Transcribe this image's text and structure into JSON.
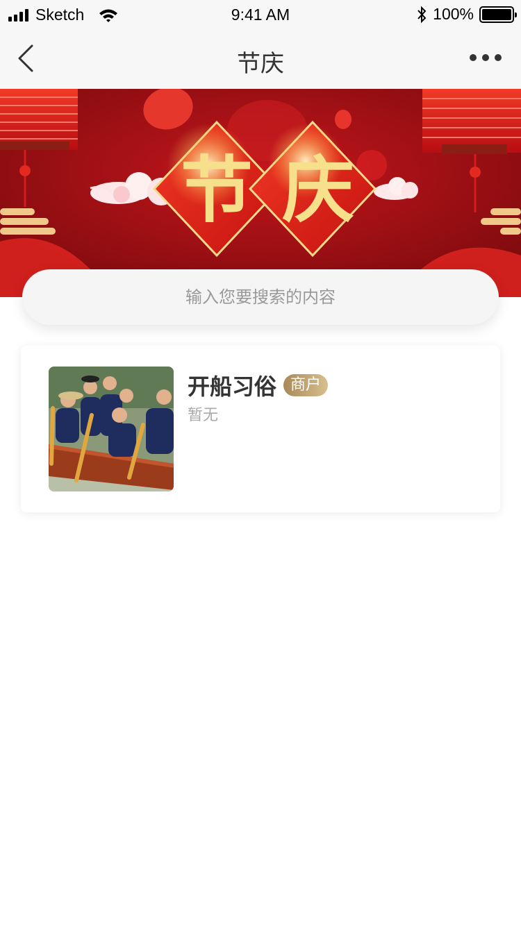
{
  "status_bar": {
    "carrier": "Sketch",
    "time": "9:41 AM",
    "battery": "100%"
  },
  "nav": {
    "title": "节庆",
    "back_icon": "chevron-left-icon",
    "more_icon": "more-dots-icon"
  },
  "banner": {
    "char1": "节",
    "char2": "庆",
    "colors": {
      "bg": "#a50f13",
      "accent": "#e3261b",
      "gold": "#f3d98a"
    }
  },
  "search": {
    "placeholder": "输入您要搜索的内容",
    "value": ""
  },
  "list": [
    {
      "title": "开船习俗",
      "badge": "商户",
      "subtitle": "暂无"
    }
  ]
}
